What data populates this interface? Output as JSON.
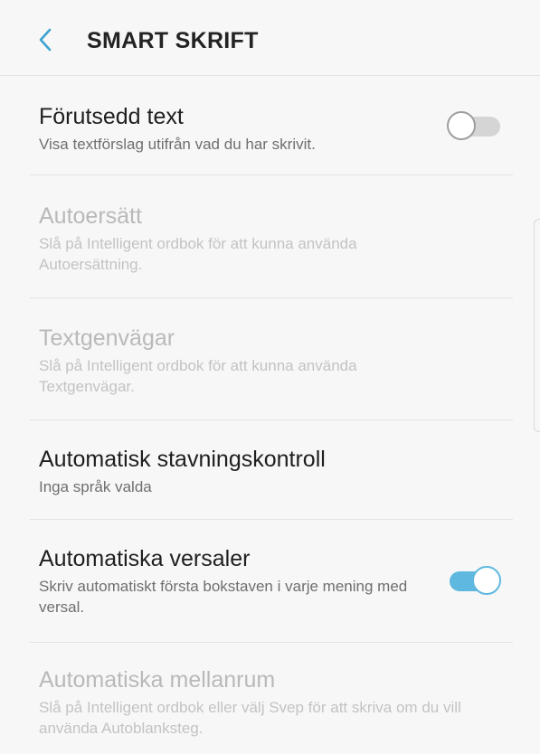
{
  "header": {
    "title": "SMART SKRIFT",
    "back_icon": "chevron-left-icon",
    "accent_color": "#5fb8e0"
  },
  "settings": [
    {
      "title": "Förutsedd text",
      "subtitle": "Visa textförslag utifrån vad du har skrivit.",
      "enabled": true,
      "toggle": "off"
    },
    {
      "title": "Autoersätt",
      "subtitle": "Slå på Intelligent ordbok för att kunna använda Autoersättning.",
      "enabled": false,
      "toggle": null
    },
    {
      "title": "Textgenvägar",
      "subtitle": "Slå på Intelligent ordbok för att kunna använda Textgenvägar.",
      "enabled": false,
      "toggle": null
    },
    {
      "title": "Automatisk stavningskontroll",
      "subtitle": "Inga språk valda",
      "enabled": true,
      "toggle": null
    },
    {
      "title": "Automatiska versaler",
      "subtitle": "Skriv automatiskt första bokstaven i varje mening med versal.",
      "enabled": true,
      "toggle": "on"
    },
    {
      "title": "Automatiska mellanrum",
      "subtitle": "Slå på Intelligent ordbok eller välj Svep för att skriva om du vill använda Autoblanksteg.",
      "enabled": false,
      "toggle": null
    }
  ]
}
